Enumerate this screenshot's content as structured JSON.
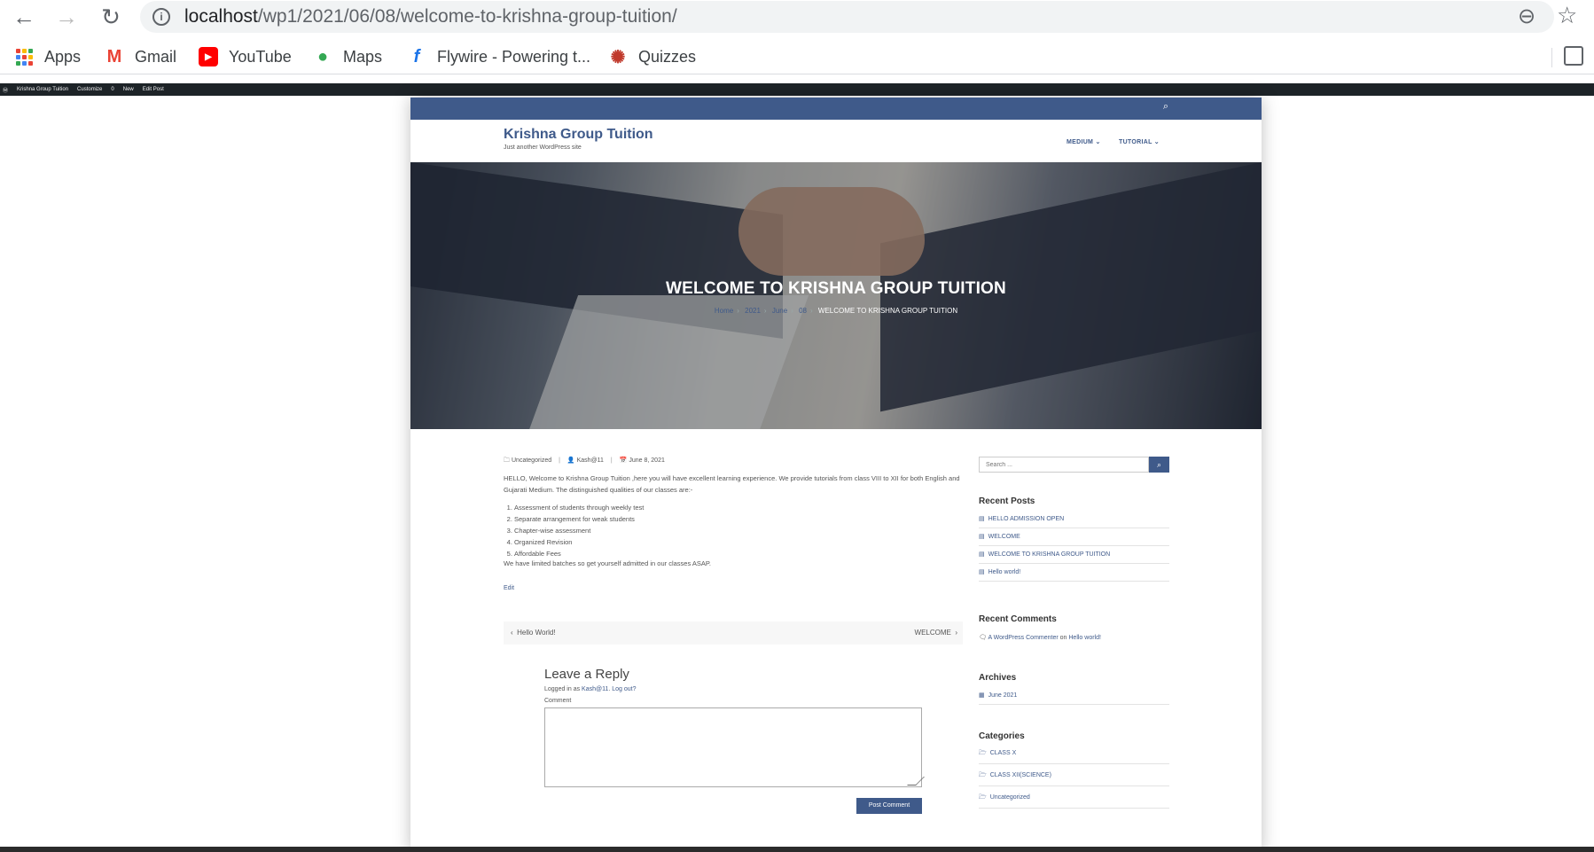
{
  "browser": {
    "url_host": "localhost",
    "url_path": "/wp1/2021/06/08/welcome-to-krishna-group-tuition/",
    "bookmarks": [
      {
        "label": "Apps",
        "icon": "apps-grid-icon"
      },
      {
        "label": "Gmail",
        "icon": "gmail-icon",
        "color": "#ea4335"
      },
      {
        "label": "YouTube",
        "icon": "youtube-icon",
        "color": "#ff0000"
      },
      {
        "label": "Maps",
        "icon": "maps-pin-icon",
        "color": "#34a853"
      },
      {
        "label": "Flywire - Powering t...",
        "icon": "flywire-icon",
        "color": "#1a73e8"
      },
      {
        "label": "Quizzes",
        "icon": "quizzes-icon",
        "color": "#c0392b"
      }
    ]
  },
  "adminbar": {
    "items": [
      "Krishna Group Tuition",
      "Customize",
      "0",
      "New",
      "Edit Post"
    ]
  },
  "site": {
    "title": "Krishna Group Tuition",
    "tagline": "Just another WordPress site",
    "menu": [
      "MEDIUM",
      "TUTORIAL"
    ],
    "accent": "#3f5a8a"
  },
  "hero": {
    "title": "WELCOME TO KRISHNA GROUP TUITION",
    "breadcrumb": [
      "Home",
      "2021",
      "June",
      "08",
      "WELCOME TO KRISHNA GROUP TUITION"
    ]
  },
  "post": {
    "meta": {
      "category": "Uncategorized",
      "author": "Kash@11",
      "date": "June 8, 2021"
    },
    "intro": "HELLO, Welcome to Krishna Group Tuition ,here you will have excellent learning experience. We provide tutorials from class VIII to XII for both English and Gujarati Medium. The distinguished qualities of our classes are:-",
    "list": [
      "Assessment of students through weekly test",
      "Separate arrangement for weak students",
      "Chapter-wise assessment",
      "Organized Revision",
      "Affordable Fees"
    ],
    "outro": "We have limited batches so get yourself admitted in our classes ASAP.",
    "edit": "Edit",
    "nav_prev": "Hello World!",
    "nav_next": "WELCOME"
  },
  "reply": {
    "title": "Leave a Reply",
    "logged_prefix": "Logged in as ",
    "user": "Kash@11",
    "logout": "Log out?",
    "comment_label": "Comment",
    "submit": "Post Comment"
  },
  "sidebar": {
    "search_placeholder": "Search ...",
    "recent_posts_title": "Recent Posts",
    "recent_posts": [
      "HELLO ADMISSION OPEN",
      "WELCOME",
      "WELCOME TO KRISHNA GROUP TUITION",
      "Hello world!"
    ],
    "recent_comments_title": "Recent Comments",
    "comment_author": "A WordPress Commenter",
    "comment_on": " on ",
    "comment_post": "Hello world!",
    "archives_title": "Archives",
    "archives": [
      "June 2021"
    ],
    "categories_title": "Categories",
    "categories": [
      "CLASS X",
      "CLASS XII(SCIENCE)",
      "Uncategorized"
    ]
  }
}
